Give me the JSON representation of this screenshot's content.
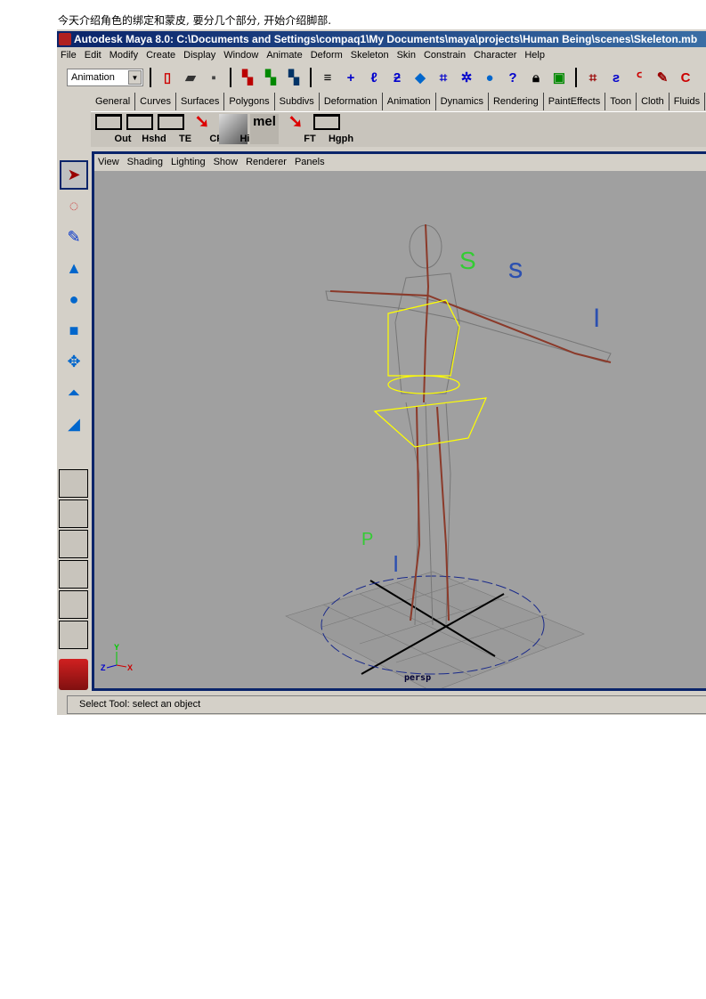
{
  "caption": "今天介绍角色的绑定和蒙皮, 要分几个部分, 开始介绍脚部.",
  "window": {
    "title": "Autodesk Maya 8.0: C:\\Documents and Settings\\compaq1\\My Documents\\maya\\projects\\Human Being\\scenes\\Skeleton.mb"
  },
  "menu": [
    "File",
    "Edit",
    "Modify",
    "Create",
    "Display",
    "Window",
    "Animate",
    "Deform",
    "Skeleton",
    "Skin",
    "Constrain",
    "Character",
    "Help"
  ],
  "toolbar": {
    "mode": "Animation"
  },
  "shelf_tabs": [
    "General",
    "Curves",
    "Surfaces",
    "Polygons",
    "Subdivs",
    "Deformation",
    "Animation",
    "Dynamics",
    "Rendering",
    "PaintEffects",
    "Toon",
    "Cloth",
    "Fluids"
  ],
  "shelf_buttons": [
    "Out",
    "Hshd",
    "TE",
    "CP",
    "His",
    "mel",
    "FT",
    "Hgph"
  ],
  "viewport": {
    "menu": [
      "View",
      "Shading",
      "Lighting",
      "Show",
      "Renderer",
      "Panels"
    ],
    "camera": "persp",
    "axis": {
      "x": "X",
      "y": "Y",
      "z": "Z"
    },
    "colors": {
      "background": "#a0a0a0",
      "border": "#0a246a",
      "selection": "#ffff00",
      "joint": "#8b3a2a"
    }
  },
  "status": "Select Tool: select an object"
}
